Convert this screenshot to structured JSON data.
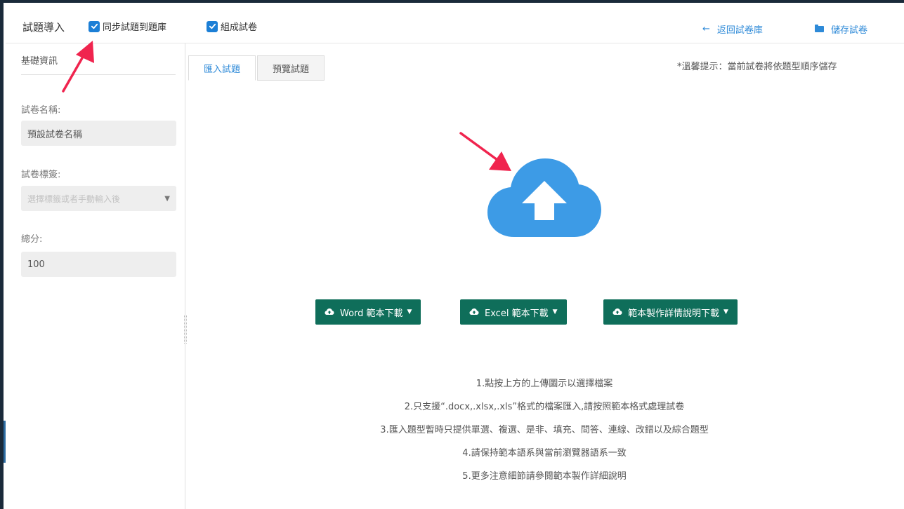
{
  "header": {
    "title": "試題導入",
    "sync_checkbox_label": "同步試題到題庫",
    "compose_checkbox_label": "組成試卷",
    "back_link": "返回試卷庫",
    "save_link": "儲存試卷"
  },
  "sidebar": {
    "heading": "基礎資訊",
    "name_label": "試卷名稱:",
    "name_value": "預設試卷名稱",
    "tag_label": "試卷標簽:",
    "tag_placeholder": "選擇標籤或者手動輸入後",
    "score_label": "總分:",
    "score_value": "100"
  },
  "tabs": [
    "匯入試題",
    "預覽試題"
  ],
  "tip": "*溫馨提示：當前試卷將依題型順序儲存",
  "download_buttons": [
    "Word 範本下載",
    "Excel 範本下載",
    "範本製作詳情說明下載"
  ],
  "instructions": [
    "1.點按上方的上傳圖示以選擇檔案",
    "2.只支援“.docx,.xlsx,.xls”格式的檔案匯入,請按照範本格式處理試卷",
    "3.匯入題型暫時只提供單選、複選、是非、填充、問答、連線、改錯以及綜合題型",
    "4.請保持範本語系與當前瀏覽器語系一致",
    "5.更多注意細節請參閱範本製作詳細說明"
  ],
  "colors": {
    "accent_blue": "#2e8ad8",
    "checkbox_blue": "#1c7fd6",
    "cloud_blue": "#3d9be6",
    "button_green": "#0f6e5a",
    "annotation_red": "#f0244e"
  },
  "icons": {
    "back": "arrow-left-icon",
    "save": "folder-icon",
    "upload": "cloud-upload-icon",
    "download": "cloud-download-icon",
    "dropdown": "chevron-down-icon"
  }
}
